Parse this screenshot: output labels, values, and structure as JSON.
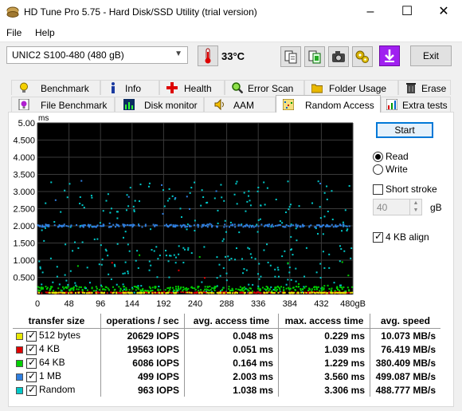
{
  "window": {
    "title": "HD Tune Pro 5.75 - Hard Disk/SSD Utility (trial version)"
  },
  "menu": [
    "File",
    "Help"
  ],
  "toolbar": {
    "drive": "UNIC2 S100-480 (480 gB)",
    "temperature": "33°C",
    "exit_label": "Exit"
  },
  "tabs_top": [
    {
      "label": "Benchmark",
      "icon": "bulb-icon"
    },
    {
      "label": "Info",
      "icon": "info-icon"
    },
    {
      "label": "Health",
      "icon": "health-cross-icon"
    },
    {
      "label": "Error Scan",
      "icon": "magnifier-icon"
    },
    {
      "label": "Folder Usage",
      "icon": "folder-icon"
    },
    {
      "label": "Erase",
      "icon": "trash-icon"
    }
  ],
  "tabs_bottom": [
    {
      "label": "File Benchmark",
      "icon": "file-bulb-icon"
    },
    {
      "label": "Disk monitor",
      "icon": "monitor-chart-icon"
    },
    {
      "label": "AAM",
      "icon": "speaker-icon"
    },
    {
      "label": "Random Access",
      "icon": "scatter-icon",
      "active": true
    },
    {
      "label": "Extra tests",
      "icon": "extra-chart-icon"
    }
  ],
  "controls": {
    "start_label": "Start",
    "read_label": "Read",
    "write_label": "Write",
    "read_selected": true,
    "short_stroke_label": "Short stroke",
    "short_stroke_checked": false,
    "short_stroke_value": "40",
    "short_stroke_unit": "gB",
    "align_label": "4 KB align",
    "align_checked": true
  },
  "chart_data": {
    "type": "scatter",
    "title": "",
    "ylabel": "ms",
    "xlabel": "gB",
    "xlim": [
      0,
      480
    ],
    "ylim": [
      0,
      5.0
    ],
    "x_ticks": [
      "0",
      "48",
      "96",
      "144",
      "192",
      "240",
      "288",
      "336",
      "384",
      "432",
      "480gB"
    ],
    "y_ticks": [
      "5.00",
      "4.500",
      "4.000",
      "3.500",
      "3.000",
      "2.500",
      "2.000",
      "1.500",
      "1.000",
      "0.500"
    ],
    "grid": true,
    "background": "#000000",
    "series": [
      {
        "name": "512 bytes",
        "color": "#e8e800",
        "typical_ms": 0.048,
        "max_ms": 0.229
      },
      {
        "name": "4 KB",
        "color": "#e00000",
        "typical_ms": 0.051,
        "max_ms": 1.039
      },
      {
        "name": "64 KB",
        "color": "#00d000",
        "typical_ms": 0.164,
        "max_ms": 1.229
      },
      {
        "name": "1 MB",
        "color": "#2f7fe0",
        "typical_ms": 2.003,
        "max_ms": 3.56
      },
      {
        "name": "Random",
        "color": "#00c8c8",
        "typical_ms": 1.038,
        "max_ms": 3.306
      }
    ]
  },
  "results": {
    "headers": [
      "transfer size",
      "operations / sec",
      "avg. access time",
      "max. access time",
      "avg. speed"
    ],
    "rows": [
      {
        "size": "512 bytes",
        "color": "#e8e800",
        "ops": "20629 IOPS",
        "avg": "0.048 ms",
        "max": "0.229 ms",
        "speed": "10.073 MB/s"
      },
      {
        "size": "4 KB",
        "color": "#e00000",
        "ops": "19563 IOPS",
        "avg": "0.051 ms",
        "max": "1.039 ms",
        "speed": "76.419 MB/s"
      },
      {
        "size": "64 KB",
        "color": "#00d000",
        "ops": "6086 IOPS",
        "avg": "0.164 ms",
        "max": "1.229 ms",
        "speed": "380.409 MB/s"
      },
      {
        "size": "1 MB",
        "color": "#2f7fe0",
        "ops": "499 IOPS",
        "avg": "2.003 ms",
        "max": "3.560 ms",
        "speed": "499.087 MB/s"
      },
      {
        "size": "Random",
        "color": "#00c8c8",
        "ops": "963 IOPS",
        "avg": "1.038 ms",
        "max": "3.306 ms",
        "speed": "488.777 MB/s"
      }
    ]
  }
}
